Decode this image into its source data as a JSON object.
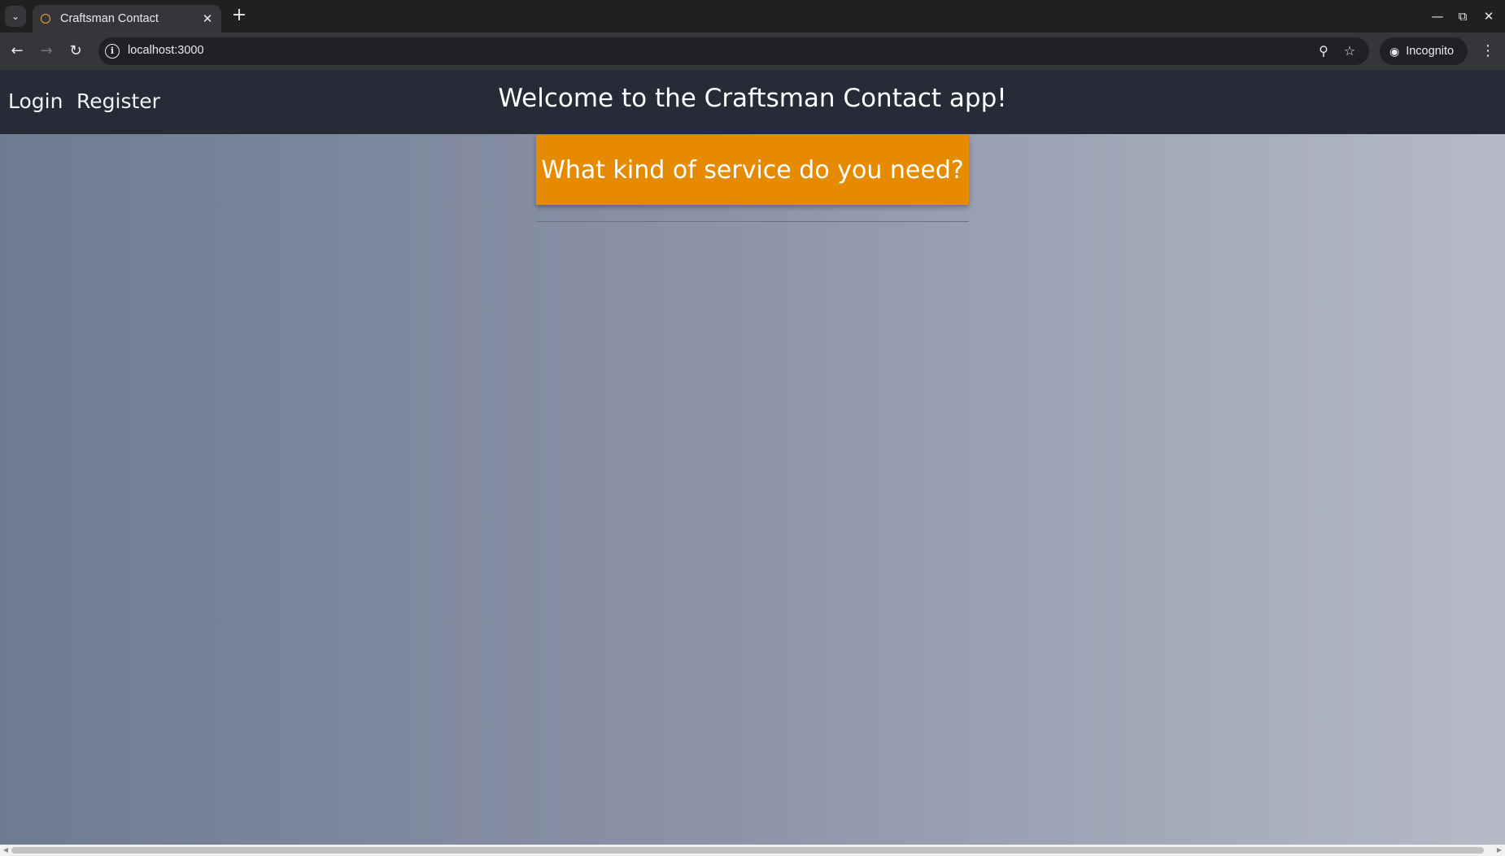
{
  "browser": {
    "tab_title": "Craftsman Contact",
    "url": "localhost:3000",
    "incognito_label": "Incognito",
    "icons": {
      "tab_list": "chevron-down-icon",
      "favicon": "loading-circle-icon",
      "tab_close": "close-icon",
      "new_tab": "plus-icon",
      "back": "arrow-left-icon",
      "forward": "arrow-right-icon",
      "reload": "reload-icon",
      "site_info": "info-icon",
      "zoom": "zoom-icon",
      "bookmark": "star-icon",
      "incognito": "incognito-icon",
      "menu": "kebab-menu-icon",
      "minimize": "minimize-icon",
      "restore": "restore-icon",
      "close_window": "close-icon"
    }
  },
  "app": {
    "nav": {
      "login": "Login",
      "register": "Register"
    },
    "title": "Welcome to the Craftsman Contact app!",
    "service_prompt": "What kind of service do you need?"
  },
  "colors": {
    "header_bg": "#262b37",
    "accent": "#e68a00",
    "gradient_start": "#6f7b90",
    "gradient_end": "#b6bac7"
  }
}
